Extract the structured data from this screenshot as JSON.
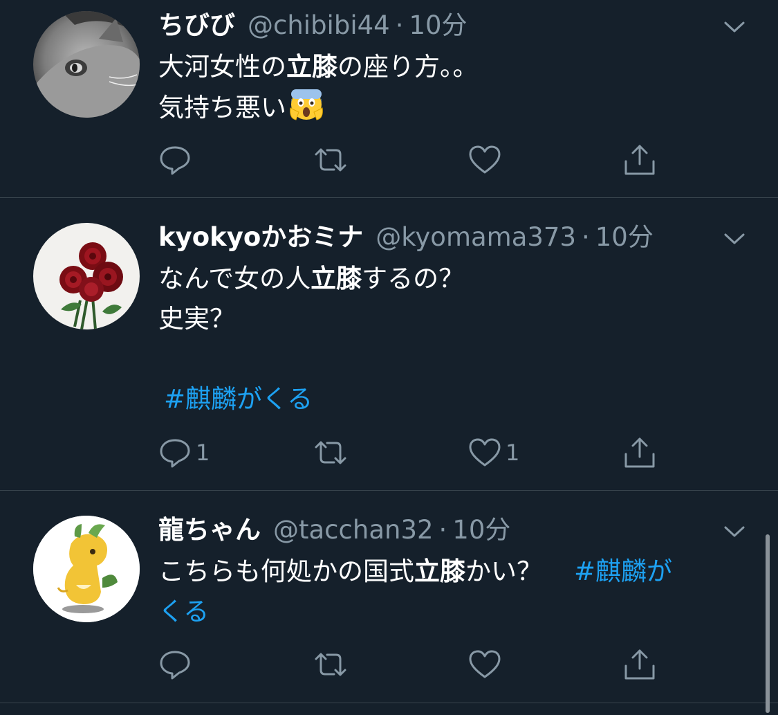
{
  "tweets": [
    {
      "name": "ちびび",
      "handle": "@chibibi44",
      "dot": "·",
      "time": "10分",
      "avatar": "cat-avatar",
      "lines": [
        [
          "大河女性の",
          "立膝",
          "の座り方。。"
        ],
        [
          "気持ち悪い"
        ]
      ],
      "emoji": "screaming-face-emoji",
      "hashtag": "",
      "actions": {
        "reply_count": "",
        "like_count": ""
      }
    },
    {
      "name": "kyokyoかおミナ",
      "handle": "@kyomama373",
      "dot": "·",
      "time": "10分",
      "avatar": "roses-avatar",
      "lines": [
        [
          "なんで女の人",
          "立膝",
          "するの？"
        ],
        [
          "史実？"
        ]
      ],
      "hashtag": "#麒麟がくる",
      "actions": {
        "reply_count": "1",
        "like_count": "1"
      }
    },
    {
      "name": "龍ちゃん",
      "handle": "@tacchan32",
      "dot": "·",
      "time": "10分",
      "avatar": "dragon-avatar",
      "lines": [
        [
          "こちらも何処かの国式",
          "立膝",
          "かい？"
        ]
      ],
      "hashtag_inline_a": "#麒麟が",
      "hashtag_inline_b": "くる",
      "actions": {
        "reply_count": "",
        "like_count": ""
      }
    }
  ],
  "colors": {
    "background": "#15202b",
    "divider": "#38444d",
    "secondary_text": "#8899a6",
    "link": "#1da1f2"
  },
  "icons": [
    "reply-icon",
    "retweet-icon",
    "like-icon",
    "share-icon",
    "chevron-down-icon"
  ]
}
